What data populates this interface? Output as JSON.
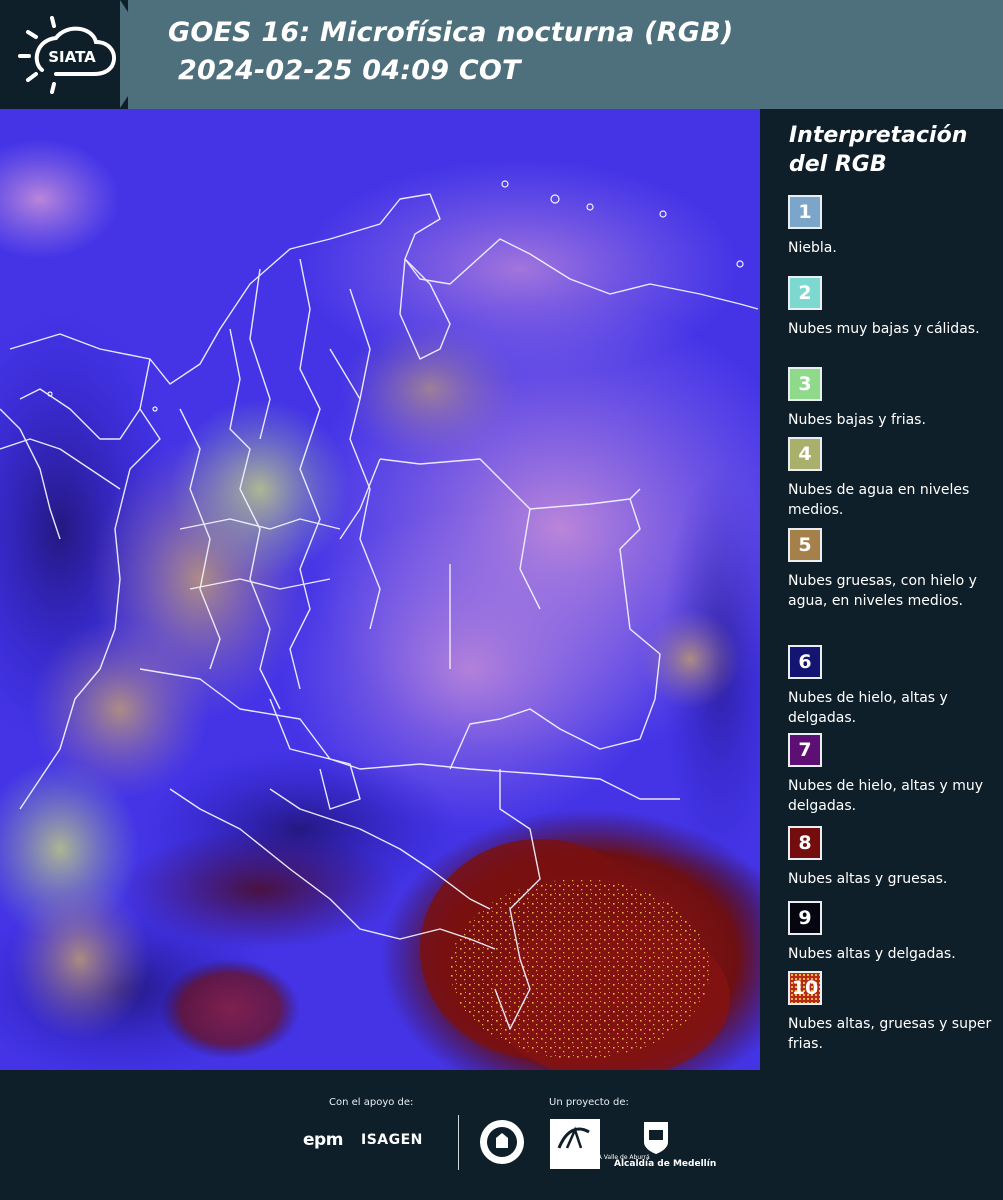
{
  "header": {
    "logo_text": "SIATA",
    "title_line1": "GOES 16: Microfísica nocturna (RGB)",
    "title_line2": "2024-02-25 04:09 COT"
  },
  "legend": {
    "title": "Interpretación del RGB",
    "items": [
      {
        "number": "1",
        "color": "#7ba6c9",
        "label": "Niebla."
      },
      {
        "number": "2",
        "color": "#7dd9cf",
        "label": "Nubes muy bajas y cálidas."
      },
      {
        "number": "3",
        "color": "#8fd98a",
        "label": "Nubes bajas y frias."
      },
      {
        "number": "4",
        "color": "#a9b06c",
        "label": "Nubes de agua en niveles medios."
      },
      {
        "number": "5",
        "color": "#a6804a",
        "label": "Nubes gruesas, con hielo y agua, en niveles medios."
      },
      {
        "number": "6",
        "color": "#141473",
        "label": "Nubes de hielo, altas y delgadas."
      },
      {
        "number": "7",
        "color": "#5e0f73",
        "label": "Nubes de hielo, altas y muy delgadas."
      },
      {
        "number": "8",
        "color": "#740e0e",
        "label": "Nubes altas y gruesas."
      },
      {
        "number": "9",
        "color": "#05060f",
        "label": "Nubes altas y delgadas."
      },
      {
        "number": "10",
        "color": "#b8291c",
        "label": "Nubes altas, gruesas y super frias."
      }
    ]
  },
  "footer": {
    "support_caption": "Con el apoyo de:",
    "project_caption": "Un proyecto de:",
    "sponsor1": "epm",
    "sponsor2": "ISAGEN",
    "amva_text": "METROPOLITANA Valle de Aburrá",
    "medellin": "Alcaldía de Medellín"
  }
}
